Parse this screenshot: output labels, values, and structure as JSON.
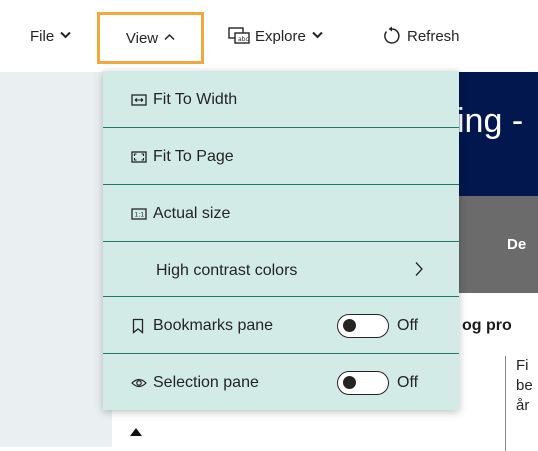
{
  "toolbar": {
    "file": "File",
    "view": "View",
    "explore": "Explore",
    "refresh": "Refresh"
  },
  "report": {
    "banner_text": "ing -",
    "grey_text": "De",
    "bold_line": "og pro",
    "text_lines": [
      "Fi",
      "be",
      "år"
    ]
  },
  "menu": {
    "fit_to_width": "Fit To Width",
    "fit_to_page": "Fit To Page",
    "actual_size": "Actual size",
    "high_contrast": "High contrast colors",
    "bookmarks_pane": "Bookmarks pane",
    "bookmarks_state": "Off",
    "selection_pane": "Selection pane",
    "selection_state": "Off"
  },
  "colors": {
    "highlight_border": "#f2a93b",
    "menu_background": "#d3ebe7",
    "separator": "#1e7a6a",
    "banner": "#03174f"
  },
  "icons": {
    "fit_to_width": "fit-width-icon",
    "fit_to_page": "fit-page-icon",
    "actual_size": "actual-size-icon",
    "bookmarks": "bookmark-icon",
    "selection": "eye-icon",
    "explore": "explore-icon",
    "refresh": "refresh-icon"
  }
}
